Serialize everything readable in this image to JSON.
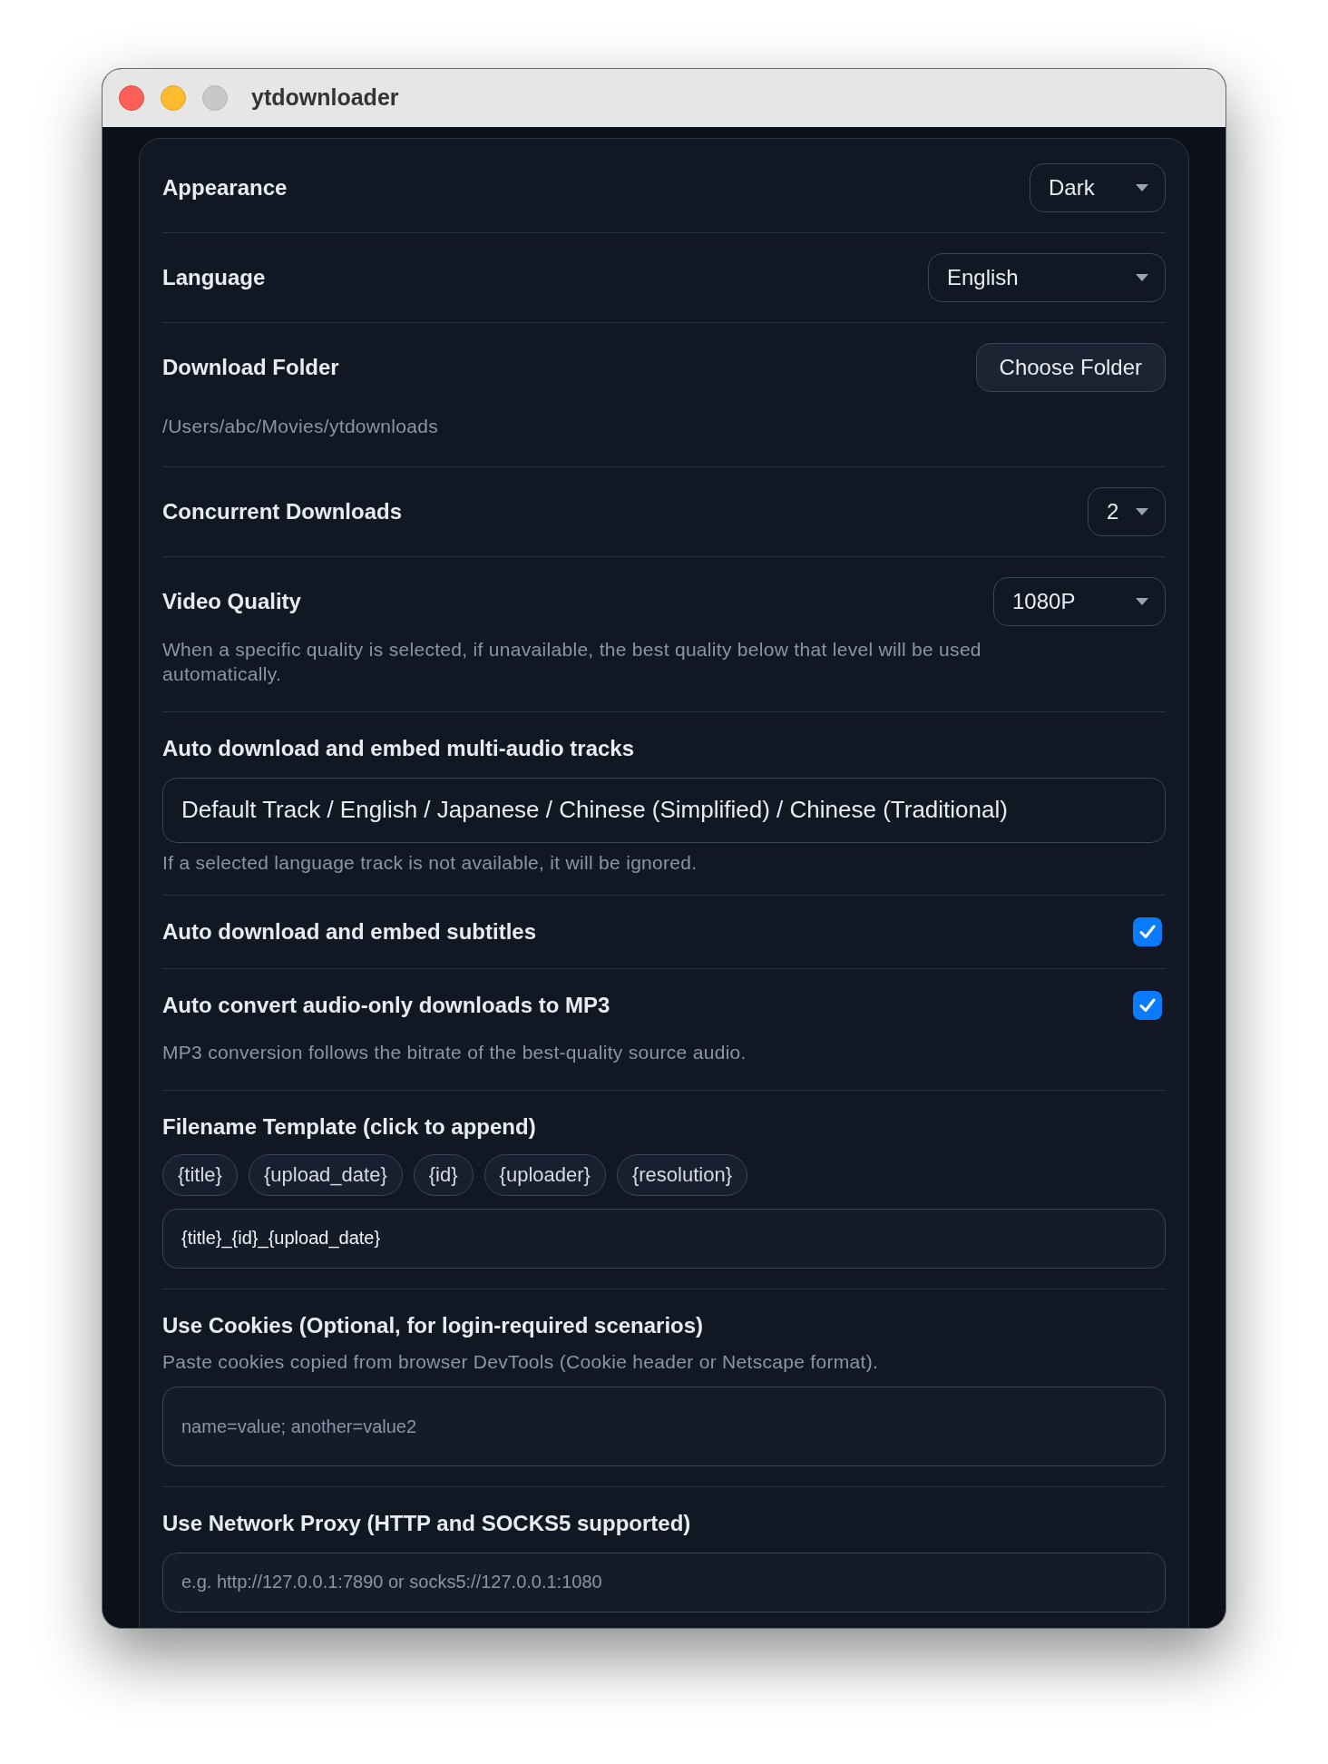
{
  "window": {
    "title": "ytdownloader"
  },
  "settings": [
    {
      "kind": "select",
      "label": "Appearance",
      "value": "Dark"
    },
    {
      "kind": "select",
      "label": "Language",
      "value": "English"
    },
    {
      "kind": "folder",
      "label": "Download Folder",
      "button": "Choose Folder",
      "path": "/Users/abc/Movies/ytdownloads"
    },
    {
      "kind": "select",
      "label": "Concurrent Downloads",
      "value": "2"
    },
    {
      "kind": "select",
      "label": "Video Quality",
      "value": "1080P",
      "hint": "When a specific quality is selected, if unavailable, the best quality below that level will be used automatically."
    },
    {
      "kind": "multi",
      "label": "Auto download and embed multi-audio tracks",
      "value": "Default Track / English / Japanese / Chinese (Simplified) / Chinese (Traditional)",
      "hint": "If a selected language track is not available, it will be ignored."
    },
    {
      "kind": "checkbox",
      "label": "Auto download and embed subtitles",
      "checked": true
    },
    {
      "kind": "checkbox",
      "label": "Auto convert audio-only downloads to MP3",
      "checked": true,
      "hint": "MP3 conversion follows the bitrate of the best-quality source audio."
    },
    {
      "kind": "template",
      "label": "Filename Template (click to append)",
      "tokens": [
        "{title}",
        "{upload_date}",
        "{id}",
        "{uploader}",
        "{resolution}"
      ],
      "value": "{title}_{id}_{upload_date}"
    },
    {
      "kind": "textarea",
      "label": "Use Cookies (Optional, for login-required scenarios)",
      "description": "Paste cookies copied from browser DevTools (Cookie header or Netscape format).",
      "placeholder": "name=value; another=value2"
    },
    {
      "kind": "input",
      "label": "Use Network Proxy (HTTP and SOCKS5 supported)",
      "placeholder": "e.g. http://127.0.0.1:7890 or socks5://127.0.0.1:1080"
    }
  ]
}
